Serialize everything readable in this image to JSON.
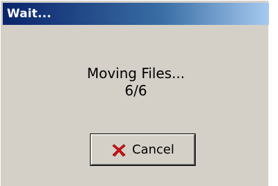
{
  "window": {
    "title": "Wait..."
  },
  "message": {
    "line1": "Moving Files...",
    "progress": "6/6"
  },
  "buttons": {
    "cancel_label": "Cancel",
    "cancel_icon": "red-x-icon"
  },
  "colors": {
    "titlebar_start": "#0a246a",
    "titlebar_end": "#a6caf0",
    "dialog_bg": "#d4d0c8",
    "cancel_icon": "#e01010"
  }
}
